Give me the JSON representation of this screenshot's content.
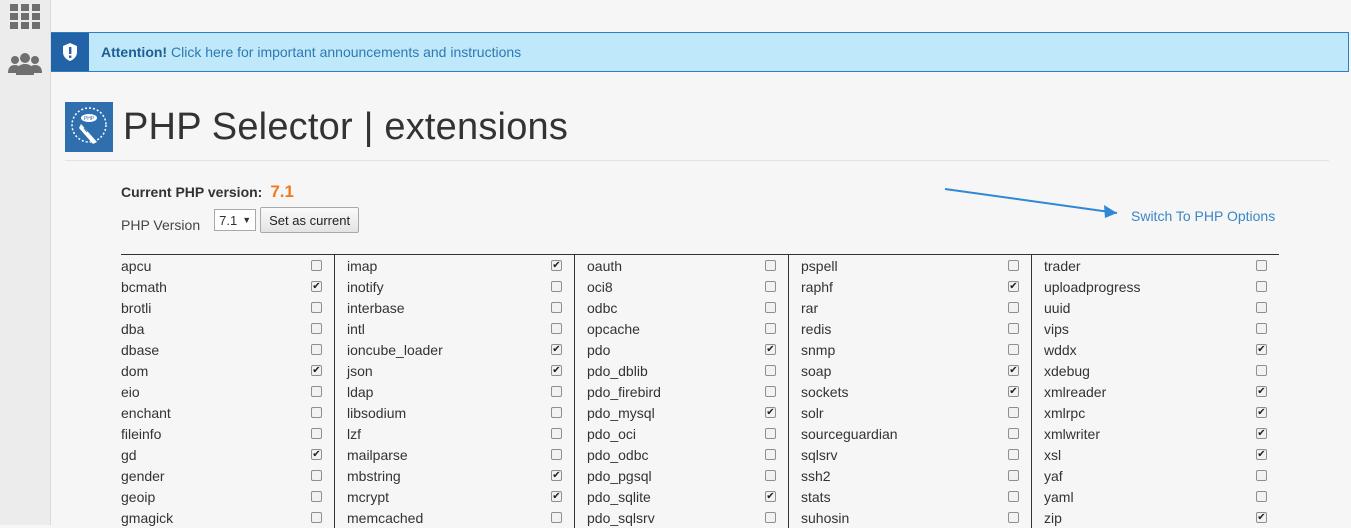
{
  "alert": {
    "strong": "Attention!",
    "text": " Click here for important announcements and instructions"
  },
  "page": {
    "title": "PHP Selector | extensions"
  },
  "current_version": {
    "label": "Current PHP version:",
    "value": "7.1"
  },
  "version_select": {
    "label": "PHP Version",
    "selected": "7.1",
    "button": "Set as current"
  },
  "switch_link": "Switch To PHP Options",
  "extensions": [
    [
      {
        "name": "apcu",
        "checked": false
      },
      {
        "name": "bcmath",
        "checked": true
      },
      {
        "name": "brotli",
        "checked": false
      },
      {
        "name": "dba",
        "checked": false
      },
      {
        "name": "dbase",
        "checked": false
      },
      {
        "name": "dom",
        "checked": true
      },
      {
        "name": "eio",
        "checked": false
      },
      {
        "name": "enchant",
        "checked": false
      },
      {
        "name": "fileinfo",
        "checked": false
      },
      {
        "name": "gd",
        "checked": true
      },
      {
        "name": "gender",
        "checked": false
      },
      {
        "name": "geoip",
        "checked": false
      },
      {
        "name": "gmagick",
        "checked": false
      }
    ],
    [
      {
        "name": "imap",
        "checked": true
      },
      {
        "name": "inotify",
        "checked": false
      },
      {
        "name": "interbase",
        "checked": false
      },
      {
        "name": "intl",
        "checked": false
      },
      {
        "name": "ioncube_loader",
        "checked": true
      },
      {
        "name": "json",
        "checked": true
      },
      {
        "name": "ldap",
        "checked": false
      },
      {
        "name": "libsodium",
        "checked": false
      },
      {
        "name": "lzf",
        "checked": false
      },
      {
        "name": "mailparse",
        "checked": false
      },
      {
        "name": "mbstring",
        "checked": true
      },
      {
        "name": "mcrypt",
        "checked": true
      },
      {
        "name": "memcached",
        "checked": false
      }
    ],
    [
      {
        "name": "oauth",
        "checked": false
      },
      {
        "name": "oci8",
        "checked": false
      },
      {
        "name": "odbc",
        "checked": false
      },
      {
        "name": "opcache",
        "checked": false
      },
      {
        "name": "pdo",
        "checked": true
      },
      {
        "name": "pdo_dblib",
        "checked": false
      },
      {
        "name": "pdo_firebird",
        "checked": false
      },
      {
        "name": "pdo_mysql",
        "checked": true
      },
      {
        "name": "pdo_oci",
        "checked": false
      },
      {
        "name": "pdo_odbc",
        "checked": false
      },
      {
        "name": "pdo_pgsql",
        "checked": false
      },
      {
        "name": "pdo_sqlite",
        "checked": true
      },
      {
        "name": "pdo_sqlsrv",
        "checked": false
      }
    ],
    [
      {
        "name": "pspell",
        "checked": false
      },
      {
        "name": "raphf",
        "checked": true
      },
      {
        "name": "rar",
        "checked": false
      },
      {
        "name": "redis",
        "checked": false
      },
      {
        "name": "snmp",
        "checked": false
      },
      {
        "name": "soap",
        "checked": true
      },
      {
        "name": "sockets",
        "checked": true
      },
      {
        "name": "solr",
        "checked": false
      },
      {
        "name": "sourceguardian",
        "checked": false
      },
      {
        "name": "sqlsrv",
        "checked": false
      },
      {
        "name": "ssh2",
        "checked": false
      },
      {
        "name": "stats",
        "checked": false
      },
      {
        "name": "suhosin",
        "checked": false
      }
    ],
    [
      {
        "name": "trader",
        "checked": false
      },
      {
        "name": "uploadprogress",
        "checked": false
      },
      {
        "name": "uuid",
        "checked": false
      },
      {
        "name": "vips",
        "checked": false
      },
      {
        "name": "wddx",
        "checked": true
      },
      {
        "name": "xdebug",
        "checked": false
      },
      {
        "name": "xmlreader",
        "checked": true
      },
      {
        "name": "xmlrpc",
        "checked": true
      },
      {
        "name": "xmlwriter",
        "checked": true
      },
      {
        "name": "xsl",
        "checked": true
      },
      {
        "name": "yaf",
        "checked": false
      },
      {
        "name": "yaml",
        "checked": false
      },
      {
        "name": "zip",
        "checked": true
      }
    ]
  ],
  "colors": {
    "accent": "#f17a1f",
    "link": "#3a86c8",
    "alert_bg": "#bfe9fb",
    "alert_badge": "#2163a6"
  },
  "icons": {
    "sidebar": [
      "apps-grid-icon",
      "users-group-icon"
    ],
    "alert": "exclamation-shield-icon",
    "logo": "php-selector-logo-icon"
  }
}
